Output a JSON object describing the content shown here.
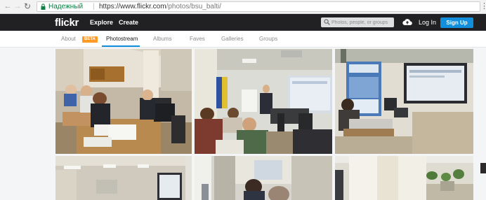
{
  "browser": {
    "secure_label": "Надежный",
    "url_base": "https://www.flickr.com",
    "url_path": "/photos/bsu_balti/"
  },
  "header": {
    "logo": "flickr",
    "explore": "Explore",
    "create": "Create",
    "search_placeholder": "Photos, people, or groups",
    "login": "Log In",
    "signup": "Sign Up"
  },
  "subnav": {
    "about": "About",
    "beta": "BETA",
    "photostream": "Photostream",
    "albums": "Albums",
    "faves": "Faves",
    "galleries": "Galleries",
    "groups": "Groups"
  },
  "colors": {
    "header_bg": "#212124",
    "signup_bg": "#128fdc",
    "beta_bg": "#ff9a26",
    "secure_green": "#0b8043"
  },
  "icons": [
    "lock-icon",
    "search-icon",
    "upload-cloud-icon",
    "more-vert-icon"
  ]
}
